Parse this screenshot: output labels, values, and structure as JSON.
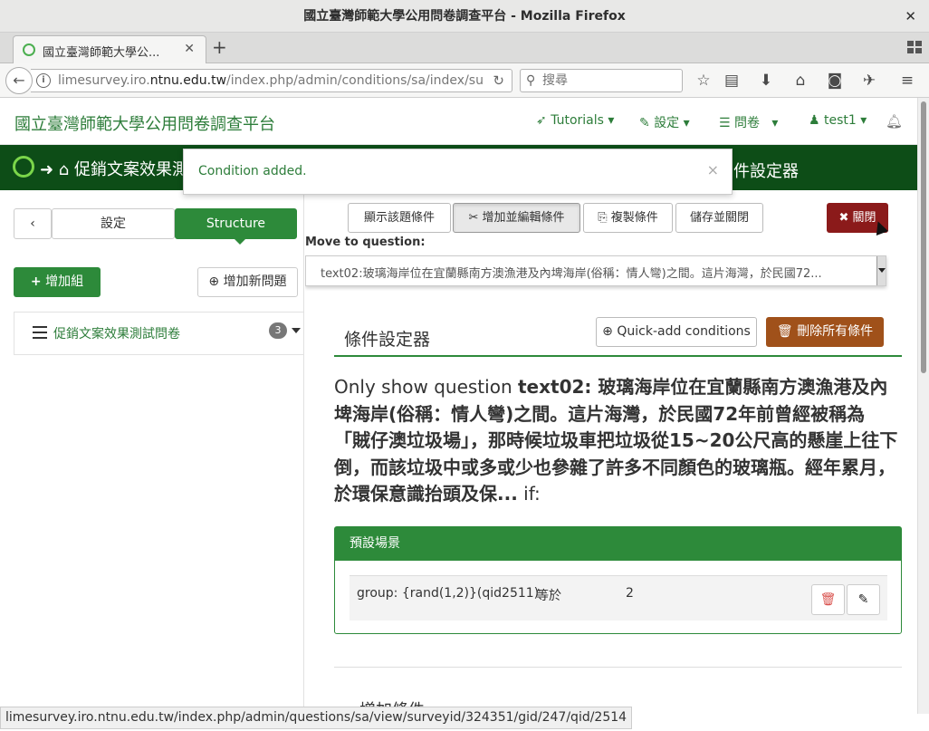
{
  "window": {
    "title": "國立臺灣師範大學公用問卷調查平台 - Mozilla Firefox",
    "close": "✕"
  },
  "tab": {
    "label": "國立臺灣師範大學公...",
    "close": "✕",
    "new": "+"
  },
  "nav": {
    "url_prefix": "limesurvey.iro.",
    "url_domain": "ntnu.edu.tw",
    "url_suffix": "/index.php/admin/conditions/sa/index/suba",
    "search_placeholder": "搜尋"
  },
  "app": {
    "brand": "國立臺灣師範大學公用問卷調查平台",
    "menu_tutorials": "Tutorials",
    "menu_settings": "設定",
    "menu_surveys": "問卷",
    "menu_user": "test1"
  },
  "greenbar": {
    "crumb": "促銷文案效果測",
    "right": "件設定器"
  },
  "alert": {
    "message": "Condition added.",
    "close": "×"
  },
  "left": {
    "settings": "設定",
    "structure": "Structure",
    "add_group": "增加組",
    "add_question": "增加新問題",
    "survey_title": "促銷文案效果測試問卷",
    "count": "3"
  },
  "toolbar": {
    "show_conditions": "顯示該題條件",
    "add_edit": "增加並編輯條件",
    "copy": "複製條件",
    "save_close": "儲存並關閉",
    "close": "關閉"
  },
  "move": {
    "label": "Move to question:",
    "selected": "text02:玻璃海岸位在宜蘭縣南方澳漁港及內埤海岸(俗稱：情人彎)之間。這片海灣，於民國72..."
  },
  "designer": {
    "title": "條件設定器",
    "quick_add": "Quick-add conditions",
    "delete_all": "刪除所有條件",
    "only_show_prefix": "Only show question ",
    "question_text": "text02: 玻璃海岸位在宜蘭縣南方澳漁港及內埤海岸(俗稱：情人彎)之間。這片海灣，於民國72年前曾經被稱為「賊仔澳垃圾場」，那時候垃圾車把垃圾從15~20公尺高的懸崖上往下倒，而該垃圾中或多或少也參雜了許多不同顏色的玻璃瓶。經年累月，於環保意識抬頭及保...",
    "only_show_suffix": " if:",
    "scenario": "預設場景",
    "condition_field": "group: {rand(1,2)}(qid2511)",
    "condition_op": "等於",
    "condition_value": "2",
    "add_condition": "增加條件"
  },
  "status": {
    "url": "limesurvey.iro.ntnu.edu.tw/index.php/admin/questions/sa/view/surveyid/324351/gid/247/qid/2514"
  },
  "colors": {
    "green": "#2d8a3a",
    "dark_green": "#0d4d17",
    "close_red": "#8b1a1a",
    "delete_orange": "#a0511a"
  }
}
